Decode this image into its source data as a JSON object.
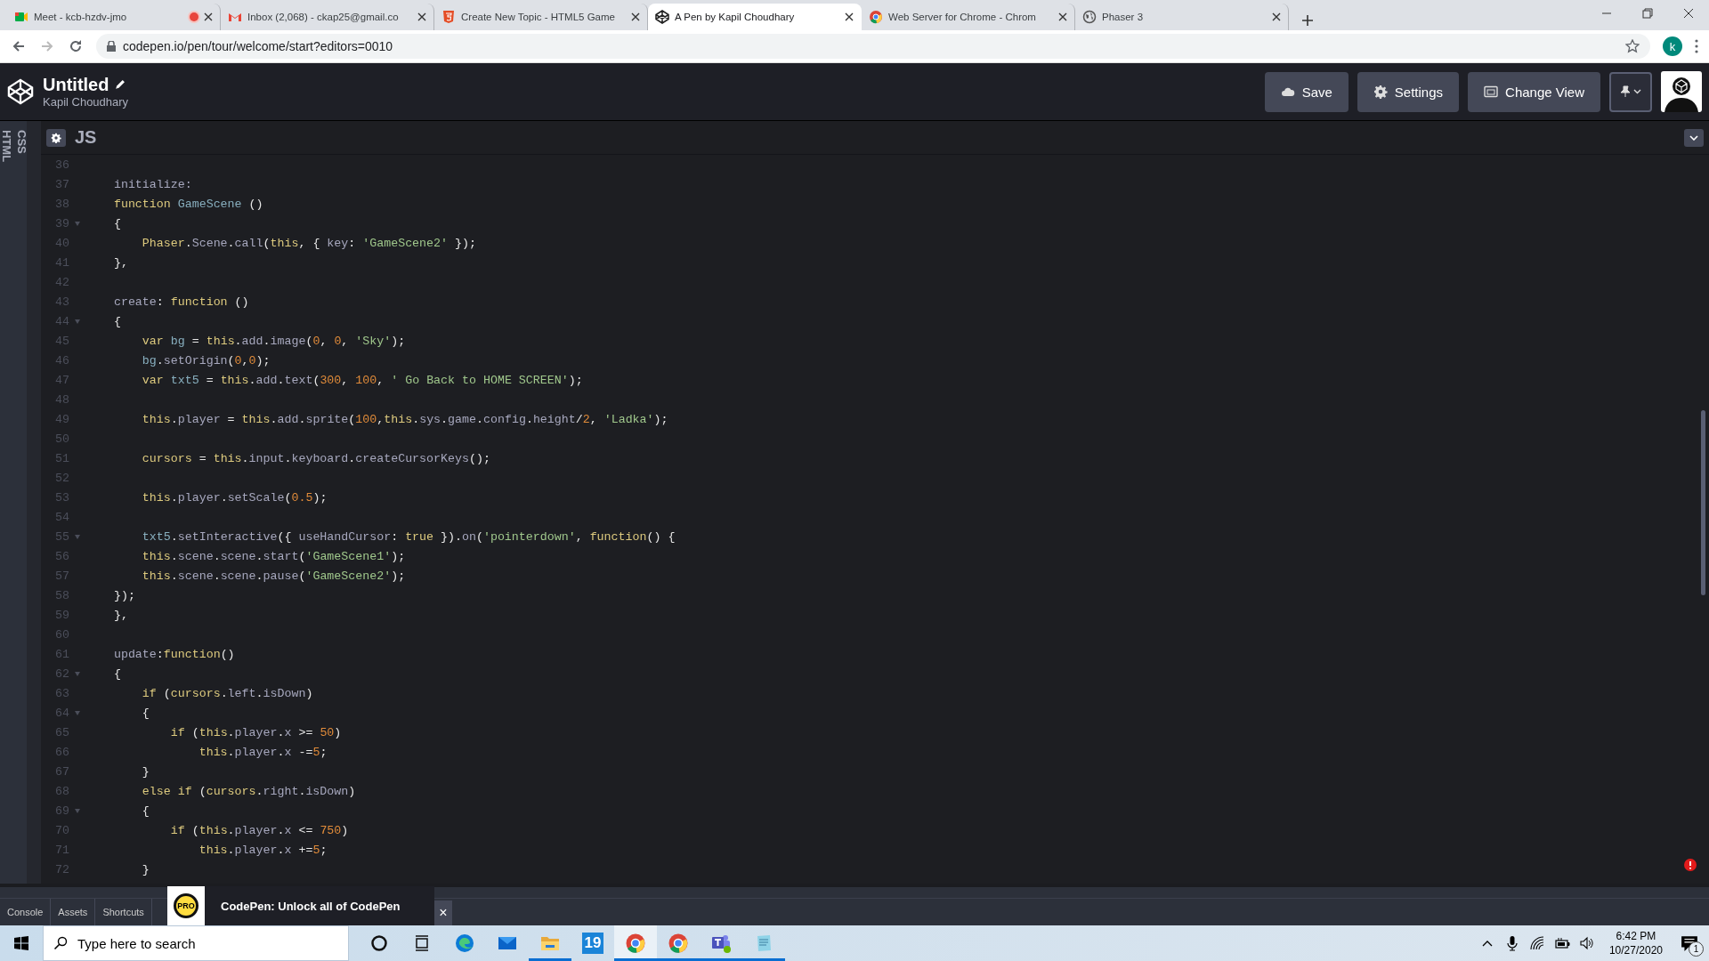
{
  "browser": {
    "tabs": [
      {
        "title": "Meet - kcb-hzdv-jmo",
        "recording": true,
        "selected": false
      },
      {
        "title": "Inbox (2,068) - ckap25@gmail.co",
        "recording": false,
        "selected": false
      },
      {
        "title": "Create New Topic - HTML5 Game",
        "recording": false,
        "selected": false
      },
      {
        "title": "A Pen by Kapil Choudhary",
        "recording": false,
        "selected": true
      },
      {
        "title": "Web Server for Chrome - Chrom",
        "recording": false,
        "selected": false
      },
      {
        "title": "Phaser 3",
        "recording": false,
        "selected": false
      }
    ],
    "address": "codepen.io/pen/tour/welcome/start?editors=0010",
    "profile": "k"
  },
  "header": {
    "title": "Untitled",
    "author": "Kapil Choudhary",
    "buttons": [
      "Save",
      "Settings",
      "Change View"
    ]
  },
  "collapsed_panels": [
    "CSS",
    "HTML"
  ],
  "editor": {
    "language": "JS",
    "lines": [
      {
        "number": "36",
        "foldable": false
      },
      {
        "number": "37",
        "foldable": false,
        "tokens": [
          {
            "kind": "prop",
            "text": "    initialize:"
          }
        ]
      },
      {
        "number": "38",
        "foldable": false,
        "tokens": [
          {
            "kind": "kw",
            "text": "    function "
          },
          {
            "kind": "def",
            "text": "GameScene"
          },
          {
            "kind": "p",
            "text": " ()"
          }
        ]
      },
      {
        "number": "39",
        "foldable": true,
        "tokens": [
          {
            "kind": "p",
            "text": "    {"
          }
        ]
      },
      {
        "number": "40",
        "foldable": false,
        "tokens": [
          {
            "kind": "kw",
            "text": "        Phaser"
          },
          {
            "kind": "p",
            "text": "."
          },
          {
            "kind": "prop",
            "text": "Scene"
          },
          {
            "kind": "p",
            "text": "."
          },
          {
            "kind": "prop",
            "text": "call"
          },
          {
            "kind": "p",
            "text": "("
          },
          {
            "kind": "kw",
            "text": "this"
          },
          {
            "kind": "p",
            "text": ", { "
          },
          {
            "kind": "prop",
            "text": "key"
          },
          {
            "kind": "p",
            "text": ": "
          },
          {
            "kind": "str",
            "text": "'GameScene2'"
          },
          {
            "kind": "p",
            "text": " });"
          }
        ]
      },
      {
        "number": "41",
        "foldable": false,
        "tokens": [
          {
            "kind": "p",
            "text": "    },"
          }
        ]
      },
      {
        "number": "42",
        "foldable": false
      },
      {
        "number": "43",
        "foldable": false,
        "tokens": [
          {
            "kind": "prop",
            "text": "    create"
          },
          {
            "kind": "p",
            "text": ": "
          },
          {
            "kind": "kw",
            "text": "function"
          },
          {
            "kind": "p",
            "text": " ()"
          }
        ]
      },
      {
        "number": "44",
        "foldable": true,
        "tokens": [
          {
            "kind": "p",
            "text": "    {"
          }
        ]
      },
      {
        "number": "45",
        "foldable": false,
        "tokens": [
          {
            "kind": "kw",
            "text": "        var "
          },
          {
            "kind": "def",
            "text": "bg"
          },
          {
            "kind": "p",
            "text": " = "
          },
          {
            "kind": "kw",
            "text": "this"
          },
          {
            "kind": "p",
            "text": "."
          },
          {
            "kind": "prop",
            "text": "add"
          },
          {
            "kind": "p",
            "text": "."
          },
          {
            "kind": "prop",
            "text": "image"
          },
          {
            "kind": "p",
            "text": "("
          },
          {
            "kind": "num",
            "text": "0"
          },
          {
            "kind": "p",
            "text": ", "
          },
          {
            "kind": "num",
            "text": "0"
          },
          {
            "kind": "p",
            "text": ", "
          },
          {
            "kind": "str",
            "text": "'Sky'"
          },
          {
            "kind": "p",
            "text": ");"
          }
        ]
      },
      {
        "number": "46",
        "foldable": false,
        "tokens": [
          {
            "kind": "def",
            "text": "        bg"
          },
          {
            "kind": "p",
            "text": "."
          },
          {
            "kind": "prop",
            "text": "setOrigin"
          },
          {
            "kind": "p",
            "text": "("
          },
          {
            "kind": "num",
            "text": "0"
          },
          {
            "kind": "p",
            "text": ","
          },
          {
            "kind": "num",
            "text": "0"
          },
          {
            "kind": "p",
            "text": ");"
          }
        ]
      },
      {
        "number": "47",
        "foldable": false,
        "tokens": [
          {
            "kind": "kw",
            "text": "        var "
          },
          {
            "kind": "def",
            "text": "txt5"
          },
          {
            "kind": "p",
            "text": " = "
          },
          {
            "kind": "kw",
            "text": "this"
          },
          {
            "kind": "p",
            "text": "."
          },
          {
            "kind": "prop",
            "text": "add"
          },
          {
            "kind": "p",
            "text": "."
          },
          {
            "kind": "prop",
            "text": "text"
          },
          {
            "kind": "p",
            "text": "("
          },
          {
            "kind": "num",
            "text": "300"
          },
          {
            "kind": "p",
            "text": ", "
          },
          {
            "kind": "num",
            "text": "100"
          },
          {
            "kind": "p",
            "text": ", "
          },
          {
            "kind": "str",
            "text": "' Go Back to HOME SCREEN'"
          },
          {
            "kind": "p",
            "text": ");"
          }
        ]
      },
      {
        "number": "48",
        "foldable": false
      },
      {
        "number": "49",
        "foldable": false,
        "tokens": [
          {
            "kind": "kw",
            "text": "        this"
          },
          {
            "kind": "p",
            "text": "."
          },
          {
            "kind": "prop",
            "text": "player"
          },
          {
            "kind": "p",
            "text": " = "
          },
          {
            "kind": "kw",
            "text": "this"
          },
          {
            "kind": "p",
            "text": "."
          },
          {
            "kind": "prop",
            "text": "add"
          },
          {
            "kind": "p",
            "text": "."
          },
          {
            "kind": "prop",
            "text": "sprite"
          },
          {
            "kind": "p",
            "text": "("
          },
          {
            "kind": "num",
            "text": "100"
          },
          {
            "kind": "p",
            "text": ","
          },
          {
            "kind": "kw",
            "text": "this"
          },
          {
            "kind": "p",
            "text": "."
          },
          {
            "kind": "prop",
            "text": "sys"
          },
          {
            "kind": "p",
            "text": "."
          },
          {
            "kind": "prop",
            "text": "game"
          },
          {
            "kind": "p",
            "text": "."
          },
          {
            "kind": "prop",
            "text": "config"
          },
          {
            "kind": "p",
            "text": "."
          },
          {
            "kind": "prop",
            "text": "height"
          },
          {
            "kind": "p",
            "text": "/"
          },
          {
            "kind": "num",
            "text": "2"
          },
          {
            "kind": "p",
            "text": ", "
          },
          {
            "kind": "str",
            "text": "'Ladka'"
          },
          {
            "kind": "p",
            "text": ");"
          }
        ]
      },
      {
        "number": "50",
        "foldable": false
      },
      {
        "number": "51",
        "foldable": false,
        "tokens": [
          {
            "kind": "kw",
            "text": "        cursors"
          },
          {
            "kind": "p",
            "text": " = "
          },
          {
            "kind": "kw",
            "text": "this"
          },
          {
            "kind": "p",
            "text": "."
          },
          {
            "kind": "prop",
            "text": "input"
          },
          {
            "kind": "p",
            "text": "."
          },
          {
            "kind": "prop",
            "text": "keyboard"
          },
          {
            "kind": "p",
            "text": "."
          },
          {
            "kind": "prop",
            "text": "createCursorKeys"
          },
          {
            "kind": "p",
            "text": "();"
          }
        ]
      },
      {
        "number": "52",
        "foldable": false
      },
      {
        "number": "53",
        "foldable": false,
        "tokens": [
          {
            "kind": "kw",
            "text": "        this"
          },
          {
            "kind": "p",
            "text": "."
          },
          {
            "kind": "prop",
            "text": "player"
          },
          {
            "kind": "p",
            "text": "."
          },
          {
            "kind": "prop",
            "text": "setScale"
          },
          {
            "kind": "p",
            "text": "("
          },
          {
            "kind": "num",
            "text": "0.5"
          },
          {
            "kind": "p",
            "text": ");"
          }
        ]
      },
      {
        "number": "54",
        "foldable": false
      },
      {
        "number": "55",
        "foldable": true,
        "tokens": [
          {
            "kind": "def",
            "text": "        txt5"
          },
          {
            "kind": "p",
            "text": "."
          },
          {
            "kind": "prop",
            "text": "setInteractive"
          },
          {
            "kind": "p",
            "text": "({ "
          },
          {
            "kind": "prop",
            "text": "useHandCursor"
          },
          {
            "kind": "p",
            "text": ": "
          },
          {
            "kind": "kw",
            "text": "true"
          },
          {
            "kind": "p",
            "text": " })."
          },
          {
            "kind": "prop",
            "text": "on"
          },
          {
            "kind": "p",
            "text": "("
          },
          {
            "kind": "str",
            "text": "'pointerdown'"
          },
          {
            "kind": "p",
            "text": ", "
          },
          {
            "kind": "kw",
            "text": "function"
          },
          {
            "kind": "p",
            "text": "() {"
          }
        ]
      },
      {
        "number": "56",
        "foldable": false,
        "tokens": [
          {
            "kind": "kw",
            "text": "        this"
          },
          {
            "kind": "p",
            "text": "."
          },
          {
            "kind": "prop",
            "text": "scene"
          },
          {
            "kind": "p",
            "text": "."
          },
          {
            "kind": "prop",
            "text": "scene"
          },
          {
            "kind": "p",
            "text": "."
          },
          {
            "kind": "prop",
            "text": "start"
          },
          {
            "kind": "p",
            "text": "("
          },
          {
            "kind": "str",
            "text": "'GameScene1'"
          },
          {
            "kind": "p",
            "text": ");"
          }
        ]
      },
      {
        "number": "57",
        "foldable": false,
        "tokens": [
          {
            "kind": "kw",
            "text": "        this"
          },
          {
            "kind": "p",
            "text": "."
          },
          {
            "kind": "prop",
            "text": "scene"
          },
          {
            "kind": "p",
            "text": "."
          },
          {
            "kind": "prop",
            "text": "scene"
          },
          {
            "kind": "p",
            "text": "."
          },
          {
            "kind": "prop",
            "text": "pause"
          },
          {
            "kind": "p",
            "text": "("
          },
          {
            "kind": "str",
            "text": "'GameScene2'"
          },
          {
            "kind": "p",
            "text": ");"
          }
        ]
      },
      {
        "number": "58",
        "foldable": false,
        "tokens": [
          {
            "kind": "p",
            "text": "    });"
          }
        ]
      },
      {
        "number": "59",
        "foldable": false,
        "tokens": [
          {
            "kind": "p",
            "text": "    },"
          }
        ]
      },
      {
        "number": "60",
        "foldable": false
      },
      {
        "number": "61",
        "foldable": false,
        "tokens": [
          {
            "kind": "prop",
            "text": "    update"
          },
          {
            "kind": "p",
            "text": ":"
          },
          {
            "kind": "kw",
            "text": "function"
          },
          {
            "kind": "p",
            "text": "()"
          }
        ]
      },
      {
        "number": "62",
        "foldable": true,
        "tokens": [
          {
            "kind": "p",
            "text": "    {"
          }
        ]
      },
      {
        "number": "63",
        "foldable": false,
        "tokens": [
          {
            "kind": "kw",
            "text": "        if "
          },
          {
            "kind": "p",
            "text": "("
          },
          {
            "kind": "kw",
            "text": "cursors"
          },
          {
            "kind": "p",
            "text": "."
          },
          {
            "kind": "prop",
            "text": "left"
          },
          {
            "kind": "p",
            "text": "."
          },
          {
            "kind": "prop",
            "text": "isDown"
          },
          {
            "kind": "p",
            "text": ")"
          }
        ]
      },
      {
        "number": "64",
        "foldable": true,
        "tokens": [
          {
            "kind": "p",
            "text": "        {"
          }
        ]
      },
      {
        "number": "65",
        "foldable": false,
        "tokens": [
          {
            "kind": "kw",
            "text": "            if "
          },
          {
            "kind": "p",
            "text": "("
          },
          {
            "kind": "kw",
            "text": "this"
          },
          {
            "kind": "p",
            "text": "."
          },
          {
            "kind": "prop",
            "text": "player"
          },
          {
            "kind": "p",
            "text": "."
          },
          {
            "kind": "prop",
            "text": "x"
          },
          {
            "kind": "p",
            "text": " >= "
          },
          {
            "kind": "num",
            "text": "50"
          },
          {
            "kind": "p",
            "text": ")"
          }
        ]
      },
      {
        "number": "66",
        "foldable": false,
        "tokens": [
          {
            "kind": "kw",
            "text": "                this"
          },
          {
            "kind": "p",
            "text": "."
          },
          {
            "kind": "prop",
            "text": "player"
          },
          {
            "kind": "p",
            "text": "."
          },
          {
            "kind": "prop",
            "text": "x"
          },
          {
            "kind": "p",
            "text": " -="
          },
          {
            "kind": "num",
            "text": "5"
          },
          {
            "kind": "p",
            "text": ";"
          }
        ]
      },
      {
        "number": "67",
        "foldable": false,
        "tokens": [
          {
            "kind": "p",
            "text": "        }"
          }
        ]
      },
      {
        "number": "68",
        "foldable": false,
        "tokens": [
          {
            "kind": "kw",
            "text": "        else if "
          },
          {
            "kind": "p",
            "text": "("
          },
          {
            "kind": "kw",
            "text": "cursors"
          },
          {
            "kind": "p",
            "text": "."
          },
          {
            "kind": "prop",
            "text": "right"
          },
          {
            "kind": "p",
            "text": "."
          },
          {
            "kind": "prop",
            "text": "isDown"
          },
          {
            "kind": "p",
            "text": ")"
          }
        ]
      },
      {
        "number": "69",
        "foldable": true,
        "tokens": [
          {
            "kind": "p",
            "text": "        {"
          }
        ]
      },
      {
        "number": "70",
        "foldable": false,
        "tokens": [
          {
            "kind": "kw",
            "text": "            if "
          },
          {
            "kind": "p",
            "text": "("
          },
          {
            "kind": "kw",
            "text": "this"
          },
          {
            "kind": "p",
            "text": "."
          },
          {
            "kind": "prop",
            "text": "player"
          },
          {
            "kind": "p",
            "text": "."
          },
          {
            "kind": "prop",
            "text": "x"
          },
          {
            "kind": "p",
            "text": " <= "
          },
          {
            "kind": "num",
            "text": "750"
          },
          {
            "kind": "p",
            "text": ")"
          }
        ]
      },
      {
        "number": "71",
        "foldable": false,
        "tokens": [
          {
            "kind": "kw",
            "text": "                this"
          },
          {
            "kind": "p",
            "text": "."
          },
          {
            "kind": "prop",
            "text": "player"
          },
          {
            "kind": "p",
            "text": "."
          },
          {
            "kind": "prop",
            "text": "x"
          },
          {
            "kind": "p",
            "text": " +="
          },
          {
            "kind": "num",
            "text": "5"
          },
          {
            "kind": "p",
            "text": ";"
          }
        ]
      },
      {
        "number": "72",
        "foldable": false,
        "tokens": [
          {
            "kind": "p",
            "text": "        }"
          }
        ]
      }
    ]
  },
  "bottom_bar": {
    "buttons": [
      "Console",
      "Assets",
      "Shortcuts"
    ],
    "promo": {
      "badge": "PRO",
      "text": "CodePen: Unlock all of CodePen",
      "close": "×"
    }
  },
  "taskbar": {
    "search": {
      "placeholder": "Type here to search"
    },
    "apps": [
      {
        "kind": "cortana",
        "running": false,
        "selected": false
      },
      {
        "kind": "taskview",
        "running": false,
        "selected": false
      },
      {
        "kind": "edge",
        "running": false,
        "selected": false
      },
      {
        "kind": "mail",
        "running": false,
        "selected": false
      },
      {
        "kind": "explorer",
        "running": true,
        "selected": false
      },
      {
        "kind": "calendar",
        "label": "19",
        "running": false,
        "selected": false
      },
      {
        "kind": "chrome",
        "running": true,
        "selected": true
      },
      {
        "kind": "chrome",
        "running": true,
        "selected": false
      },
      {
        "kind": "teams",
        "running": true,
        "selected": false
      },
      {
        "kind": "notepad",
        "running": true,
        "selected": false
      }
    ],
    "time": "6:42 PM",
    "date": "10/27/2020",
    "notifications": "1"
  }
}
